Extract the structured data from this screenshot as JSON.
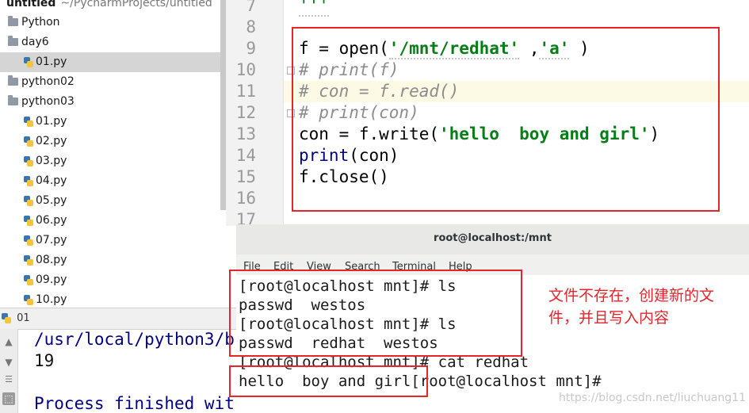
{
  "project": {
    "root_name": "untitled",
    "root_path": "~/PycharmProjects/untitled",
    "items": [
      {
        "label": "Python",
        "kind": "folder",
        "indent": 1
      },
      {
        "label": "day6",
        "kind": "folder",
        "indent": 1
      },
      {
        "label": "01.py",
        "kind": "file",
        "indent": 2,
        "selected": true
      },
      {
        "label": "python02",
        "kind": "folder",
        "indent": 1
      },
      {
        "label": "python03",
        "kind": "folder",
        "indent": 1
      },
      {
        "label": "01.py",
        "kind": "file",
        "indent": 2
      },
      {
        "label": "02.py",
        "kind": "file",
        "indent": 2
      },
      {
        "label": "03.py",
        "kind": "file",
        "indent": 2
      },
      {
        "label": "04.py",
        "kind": "file",
        "indent": 2
      },
      {
        "label": "05.py",
        "kind": "file",
        "indent": 2
      },
      {
        "label": "06.py",
        "kind": "file",
        "indent": 2
      },
      {
        "label": "07.py",
        "kind": "file",
        "indent": 2
      },
      {
        "label": "08.py",
        "kind": "file",
        "indent": 2
      },
      {
        "label": "09.py",
        "kind": "file",
        "indent": 2
      },
      {
        "label": "10.py",
        "kind": "file",
        "indent": 2
      }
    ]
  },
  "editor": {
    "line_numbers": [
      "7",
      "8",
      "9",
      "10",
      "11",
      "12",
      "13",
      "14",
      "15",
      "16",
      "17"
    ],
    "code": {
      "l7": "'''",
      "l9_a": "f = open(",
      "l9_s1": "'/mnt/redhat'",
      "l9_b": " ,",
      "l9_s2": "'a'",
      "l9_c": " )",
      "l10": "# print(f)",
      "l11": "# con = f.read()",
      "l12": "# print(con)",
      "l13_a": "con = f.write(",
      "l13_s": "'hello  boy and girl'",
      "l13_b": ")",
      "l14_a": "print",
      "l14_b": "(con)",
      "l15": "f.close()"
    }
  },
  "run": {
    "tab_label": "01",
    "lines": [
      "/usr/local/python3/b",
      "19",
      "",
      "Process finished wit"
    ]
  },
  "terminal": {
    "title": "root@localhost:/mnt",
    "menu": [
      "File",
      "Edit",
      "View",
      "Search",
      "Terminal",
      "Help"
    ],
    "lines": [
      "[root@localhost mnt]# ls",
      "passwd  westos",
      "[root@localhost mnt]# ls",
      "passwd  redhat  westos",
      "[root@localhost mnt]# cat redhat",
      "hello  boy and girl[root@localhost mnt]#"
    ]
  },
  "annotation": {
    "text_line1": "文件不存在，创建新的文",
    "text_line2": "件，并且写入内容",
    "color": "#e8232a"
  },
  "watermark": "https://blog.csdn.net/liuchuang11",
  "colors": {
    "string": "#067d17",
    "comment": "#8c8c8c",
    "builtin": "#000080",
    "selection": "#d5d5d5",
    "annotation_red": "#e8232a"
  }
}
